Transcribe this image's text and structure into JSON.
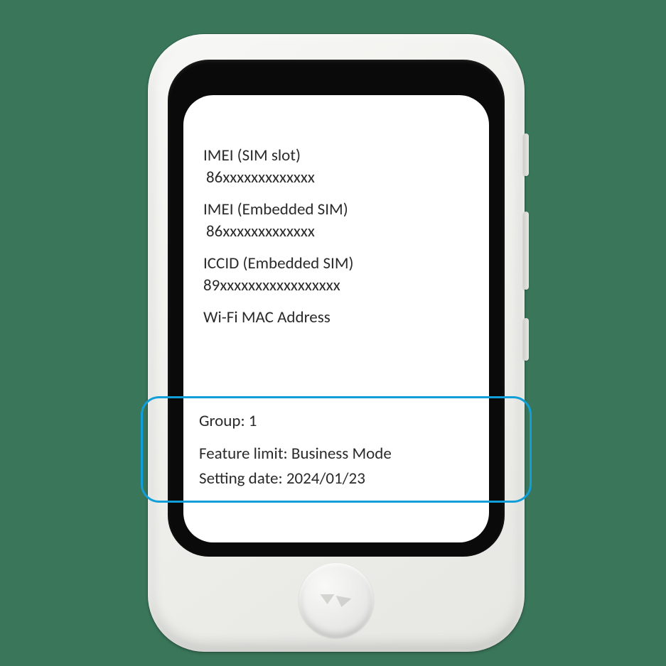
{
  "device_info": {
    "imei_sim_slot": {
      "label": "IMEI (SIM slot)",
      "value": "86xxxxxxxxxxxxx"
    },
    "imei_embedded": {
      "label": "IMEI (Embedded SIM)",
      "value": "86xxxxxxxxxxxxx"
    },
    "iccid_embedded": {
      "label": "ICCID (Embedded SIM)",
      "value": "89xxxxxxxxxxxxxxxxx"
    },
    "wifi_mac": {
      "label": "Wi-Fi MAC Address"
    }
  },
  "highlight": {
    "group": "Group: 1",
    "feature_limit": "Feature limit: Business Mode",
    "setting_date": "Setting date: 2024/01/23"
  },
  "colors": {
    "background": "#3a765a",
    "callout_border": "#109fd8"
  }
}
